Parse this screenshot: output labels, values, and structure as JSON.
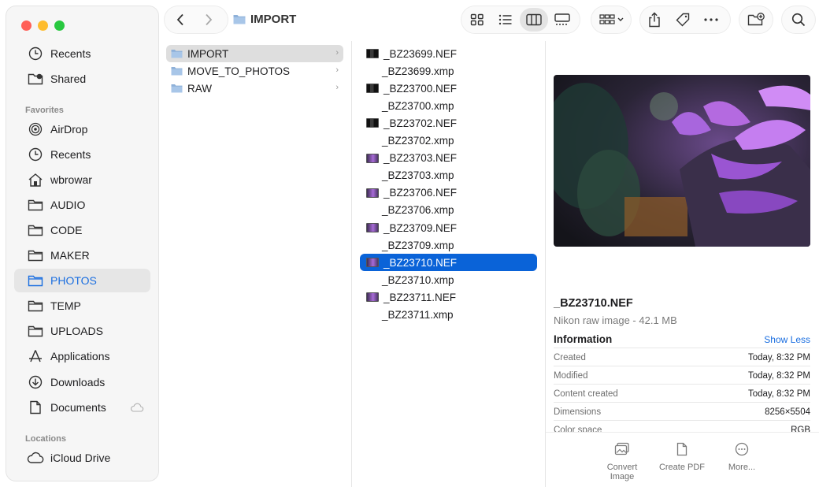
{
  "window": {
    "title": "IMPORT"
  },
  "sidebar": {
    "top_items": [
      {
        "label": "Recents",
        "icon": "clock-icon"
      },
      {
        "label": "Shared",
        "icon": "shared-folder-icon"
      }
    ],
    "favorites_header": "Favorites",
    "favorites": [
      {
        "label": "AirDrop",
        "icon": "airdrop-icon"
      },
      {
        "label": "Recents",
        "icon": "clock-icon"
      },
      {
        "label": "wbrowar",
        "icon": "home-icon"
      },
      {
        "label": "AUDIO",
        "icon": "folder-icon"
      },
      {
        "label": "CODE",
        "icon": "folder-icon"
      },
      {
        "label": "MAKER",
        "icon": "folder-icon"
      },
      {
        "label": "PHOTOS",
        "icon": "folder-icon",
        "selected": true
      },
      {
        "label": "TEMP",
        "icon": "folder-icon"
      },
      {
        "label": "UPLOADS",
        "icon": "folder-icon"
      },
      {
        "label": "Applications",
        "icon": "applications-icon"
      },
      {
        "label": "Downloads",
        "icon": "download-icon"
      },
      {
        "label": "Documents",
        "icon": "document-icon"
      }
    ],
    "locations_header": "Locations",
    "locations": [
      {
        "label": "iCloud Drive",
        "icon": "cloud-icon"
      }
    ]
  },
  "column1": [
    {
      "label": "IMPORT",
      "selected": true
    },
    {
      "label": "MOVE_TO_PHOTOS"
    },
    {
      "label": "RAW"
    }
  ],
  "column2": [
    {
      "label": "_BZ23699.NEF",
      "thumb": "dark"
    },
    {
      "label": "_BZ23699.xmp"
    },
    {
      "label": "_BZ23700.NEF",
      "thumb": "dark"
    },
    {
      "label": "_BZ23700.xmp"
    },
    {
      "label": "_BZ23702.NEF",
      "thumb": "dark"
    },
    {
      "label": "_BZ23702.xmp"
    },
    {
      "label": "_BZ23703.NEF",
      "thumb": "purple"
    },
    {
      "label": "_BZ23703.xmp"
    },
    {
      "label": "_BZ23706.NEF",
      "thumb": "purple"
    },
    {
      "label": "_BZ23706.xmp"
    },
    {
      "label": "_BZ23709.NEF",
      "thumb": "purple"
    },
    {
      "label": "_BZ23709.xmp"
    },
    {
      "label": "_BZ23710.NEF",
      "thumb": "purple",
      "selected": true
    },
    {
      "label": "_BZ23710.xmp"
    },
    {
      "label": "_BZ23711.NEF",
      "thumb": "purple"
    },
    {
      "label": "_BZ23711.xmp"
    }
  ],
  "preview": {
    "file_name": "_BZ23710.NEF",
    "subtitle": "Nikon raw image - 42.1 MB",
    "info_header": "Information",
    "show_less": "Show Less",
    "info_rows": [
      {
        "key": "Created",
        "value": "Today, 8:32 PM"
      },
      {
        "key": "Modified",
        "value": "Today, 8:32 PM"
      },
      {
        "key": "Content created",
        "value": "Today, 8:32 PM"
      },
      {
        "key": "Dimensions",
        "value": "8256×5504"
      },
      {
        "key": "Color space",
        "value": "RGB"
      }
    ],
    "actions": [
      {
        "label": "Convert Image",
        "icon": "convert-image-icon"
      },
      {
        "label": "Create PDF",
        "icon": "pdf-icon"
      },
      {
        "label": "More...",
        "icon": "more-icon"
      }
    ]
  },
  "colors": {
    "accent": "#0a63d8",
    "selected_sidebar_text": "#1a6ee0"
  }
}
